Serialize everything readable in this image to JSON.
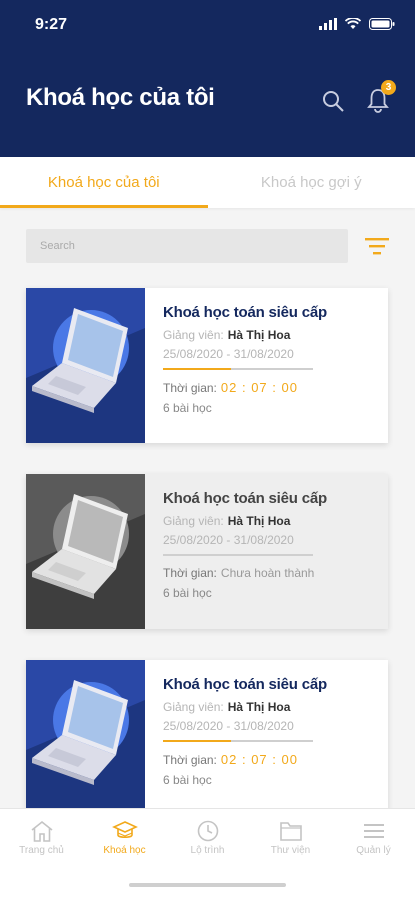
{
  "status_bar": {
    "time": "9:27"
  },
  "header": {
    "title": "Khoá học của tôi",
    "notification_count": "3"
  },
  "tabs": [
    {
      "label": "Khoá học của tôi",
      "active": true
    },
    {
      "label": "Khoá học gợi ý",
      "active": false
    }
  ],
  "search": {
    "placeholder": "Search"
  },
  "courses": [
    {
      "name": "Khoá học toán siêu cấp",
      "instructor_label": "Giảng viên:",
      "instructor": "Hà Thị Hoa",
      "dates": "25/08/2020 - 31/08/2020",
      "progress": 0.45,
      "time_label": "Thời gian:",
      "time_value": "02 : 07 : 00",
      "lessons": "6 bài học",
      "status": "active"
    },
    {
      "name": "Khoá học toán siêu cấp",
      "instructor_label": "Giảng viên:",
      "instructor": "Hà Thị Hoa",
      "dates": "25/08/2020 - 31/08/2020",
      "progress": 0,
      "time_label": "Thời gian:",
      "time_value": "Chưa hoàn thành",
      "lessons": "6 bài học",
      "status": "disabled"
    },
    {
      "name": "Khoá học toán siêu cấp",
      "instructor_label": "Giảng viên:",
      "instructor": "Hà Thị Hoa",
      "dates": "25/08/2020 - 31/08/2020",
      "progress": 0.45,
      "time_label": "Thời gian:",
      "time_value": "02 : 07 : 00",
      "lessons": "6 bài học",
      "status": "active"
    }
  ],
  "bottom_nav": [
    {
      "label": "Trang chủ",
      "icon": "home-icon",
      "active": false
    },
    {
      "label": "Khoá học",
      "icon": "graduation-cap-icon",
      "active": true
    },
    {
      "label": "Lộ trình",
      "icon": "clock-icon",
      "active": false
    },
    {
      "label": "Thư viện",
      "icon": "folder-icon",
      "active": false
    },
    {
      "label": "Quản lý",
      "icon": "menu-icon",
      "active": false
    }
  ],
  "colors": {
    "header_bg": "#14285e",
    "accent": "#f2a91b",
    "thumb_bg": "#2a48a6",
    "thumb_bg_disabled": "#5a5a5a"
  }
}
